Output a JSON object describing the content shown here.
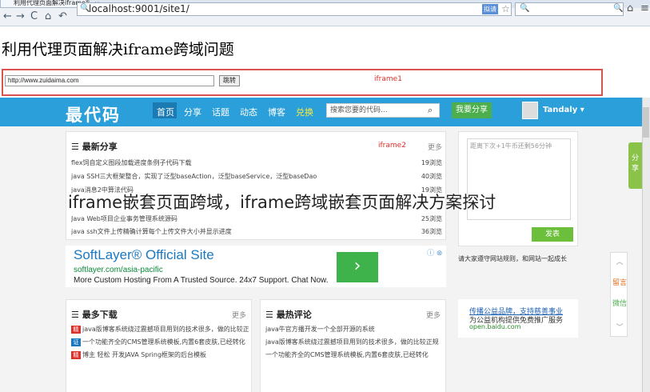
{
  "browser": {
    "tab_title": "利用代理页面解决iframe跨",
    "tab_close": "×",
    "address": "localhost:9001/site1/",
    "translate_label": "拟请",
    "icons": {
      "back": "←",
      "forward": "→",
      "refresh": "C",
      "home": "⌂",
      "undo": "↶",
      "search": "🔍",
      "star": "☆",
      "menu": "≡"
    }
  },
  "page": {
    "title": "利用代理页面解决iframe跨域问题",
    "url_value": "http://www.zuidaima.com",
    "jump_label": "跳转",
    "iframe1_label": "iframe1"
  },
  "site": {
    "logo": "最代码",
    "nav": [
      {
        "label": "首页"
      },
      {
        "label": "分享"
      },
      {
        "label": "话题"
      },
      {
        "label": "动态"
      },
      {
        "label": "博客"
      },
      {
        "label": "兑换"
      }
    ],
    "search_placeholder": "搜索您要的代码...",
    "share_button": "我要分享",
    "user_name": "Tandaly ▾",
    "latest": {
      "title": "最新分享",
      "more": "更多",
      "iframe2_label": "iframe2",
      "items": [
        {
          "text": "flex饲自定义图段加载进度条例子代码下载",
          "count": "19浏览"
        },
        {
          "text": "java SSH三大框架整合，实现了泛型baseAction，泛型baseService，泛型baseDao",
          "count": "40浏览"
        },
        {
          "text": "java消息2中算法代码",
          "count": "19浏览"
        },
        {
          "text": "Java Web项目企业事务管理系统源码",
          "count": "25浏览"
        },
        {
          "text": "java ssh文件上传精确计算每个上传文件大小并显示进度",
          "count": "36浏览"
        }
      ]
    },
    "ad": {
      "title": "SoftLayer® Official Site",
      "url": "softlayer.com/asia-pacific",
      "desc": "More Custom Hosting From A Trusted Source. 24x7 Support. Chat Now.",
      "arrow": "›",
      "close": "ⓘ ⊗"
    },
    "downloads": {
      "title": "最多下载",
      "more": "更多",
      "items": [
        {
          "tag": "精",
          "tag_color": "#e0302c",
          "text": "java版博客系统绕过震撼项目用到的技术很多，做的比较正规"
        },
        {
          "tag": "证",
          "tag_color": "#1a78c2",
          "text": "一个功能齐全的CMS管理系统模板,内置6套皮肤,已经转化"
        },
        {
          "tag": "精",
          "tag_color": "#e0302c",
          "text": "博主 轻松 开发JAVA Spring框架的后台模板"
        }
      ]
    },
    "comments": {
      "title": "最热评论",
      "more": "更多",
      "items": [
        {
          "text": "java牛官方播开发一个全部开源的系统"
        },
        {
          "text": "java版博客系统绕过震撼项目用到的技术很多，做的比较正规"
        },
        {
          "text": "一个功能齐全的CMS管理系统模板,内置6套皮肤,已经转化"
        }
      ]
    },
    "msg": {
      "placeholder": "距离下次+1牛币还剩56分钟",
      "send": "发表",
      "notice": "请大家遵守网站规则，和网站一起成长"
    },
    "side_share": "分享",
    "side_tools": [
      "︿",
      "留言",
      "微信",
      "﹀"
    ],
    "ad2": {
      "line1": "传播公益品牌，支持慈善事业",
      "line2": "为公益机构提供免费推广服务",
      "line3": "open.baidu.com"
    }
  },
  "caption": "iframe嵌套页面跨域，iframe跨域嵌套页面解决方案探讨"
}
